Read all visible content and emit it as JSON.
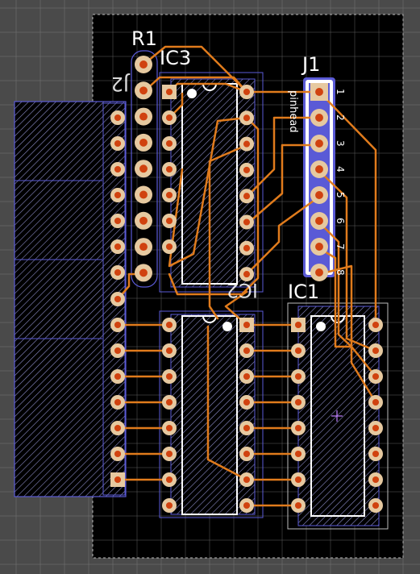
{
  "app": {
    "view": "PCB board layout"
  },
  "colors": {
    "background": "#4a4a4a",
    "board": "#000000",
    "grid": "#8a8a8a",
    "trace": "#e07b1c",
    "pad_ring": "#e6c9a0",
    "pad_center": "#d0420f",
    "outline": "#5a5ad6",
    "silk": "#ffffff",
    "hatch": "#8c8cc8"
  },
  "labels": {
    "r1": "R1",
    "ic3": "IC3",
    "j1": "J1",
    "j2": "J2",
    "ic2": "IC2",
    "ic1": "IC1",
    "j1_value": "pinhead"
  },
  "j1_pins": [
    "1",
    "2",
    "3",
    "4",
    "5",
    "6",
    "7",
    "8"
  ],
  "tool": {
    "cursor": "crosshair-icon"
  }
}
